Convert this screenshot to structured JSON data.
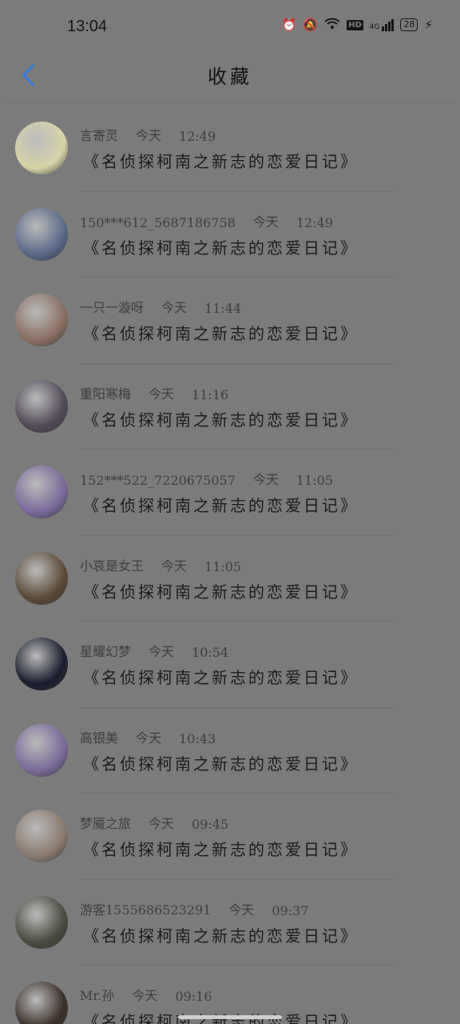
{
  "status_bar": {
    "time": "13:04",
    "icons": [
      "alarm-icon",
      "mute-bell-icon",
      "wifi-icon",
      "hd-icon",
      "signal-4g-icon",
      "battery-icon",
      "charging-icon"
    ],
    "hd_label": "HD",
    "network_label": "4G",
    "battery_level": "28"
  },
  "header": {
    "title": "收藏",
    "back_icon": "chevron-left-icon",
    "accent_color": "#3a7bd5"
  },
  "favorites": [
    {
      "user": "言寄灵",
      "time_prefix": "今天",
      "time": "12:49",
      "content": "《名侦探柯南之新志的恋爱日记》",
      "avatar_color": "#d8d4a8"
    },
    {
      "user": "150***612_5687186758",
      "time_prefix": "今天",
      "time": "12:49",
      "content": "《名侦探柯南之新志的恋爱日记》",
      "avatar_color": "#5a6a8a"
    },
    {
      "user": "一只一漩呀",
      "time_prefix": "今天",
      "time": "11:44",
      "content": "《名侦探柯南之新志的恋爱日记》",
      "avatar_color": "#8a6f62"
    },
    {
      "user": "重阳寒梅",
      "time_prefix": "今天",
      "time": "11:16",
      "content": "《名侦探柯南之新志的恋爱日记》",
      "avatar_color": "#514a58"
    },
    {
      "user": "152***522_7220675057",
      "time_prefix": "今天",
      "time": "11:05",
      "content": "《名侦探柯南之新志的恋爱日记》",
      "avatar_color": "#7a6a9b"
    },
    {
      "user": "小哀是女王",
      "time_prefix": "今天",
      "time": "11:05",
      "content": "《名侦探柯南之新志的恋爱日记》",
      "avatar_color": "#5c4a36"
    },
    {
      "user": "星耀幻梦",
      "time_prefix": "今天",
      "time": "10:54",
      "content": "《名侦探柯南之新志的恋爱日记》",
      "avatar_color": "#1a1d2e"
    },
    {
      "user": "高银美",
      "time_prefix": "今天",
      "time": "10:43",
      "content": "《名侦探柯南之新志的恋爱日记》",
      "avatar_color": "#7a6a9b"
    },
    {
      "user": "梦魇之旅",
      "time_prefix": "今天",
      "time": "09:45",
      "content": "《名侦探柯南之新志的恋爱日记》",
      "avatar_color": "#8a7a6e"
    },
    {
      "user": "游客1555686523291",
      "time_prefix": "今天",
      "time": "09:37",
      "content": "《名侦探柯南之新志的恋爱日记》",
      "avatar_color": "#4a4a40"
    },
    {
      "user": "Mr.孙",
      "time_prefix": "今天",
      "time": "09:16",
      "content": "《名侦探柯南之新志的恋爱日记》",
      "avatar_color": "#3a2e28"
    }
  ]
}
